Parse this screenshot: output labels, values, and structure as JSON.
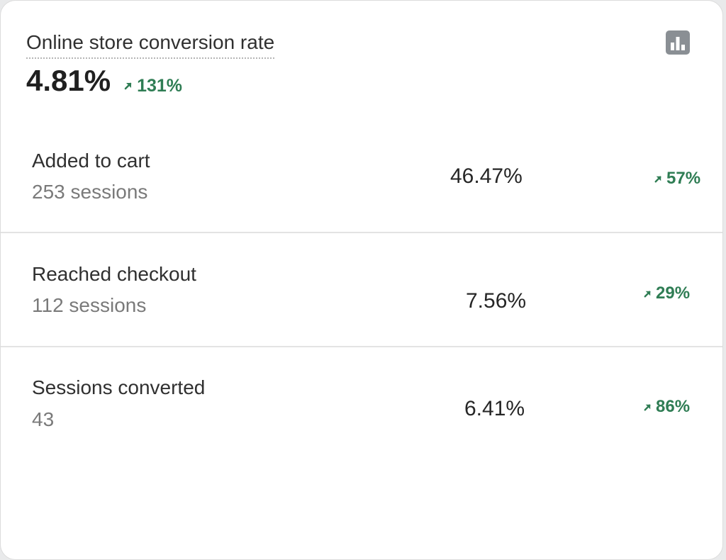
{
  "card": {
    "title": "Online store conversion rate",
    "value": "4.81%",
    "change": "131%",
    "chart_icon": "bar-chart-icon"
  },
  "rows": [
    {
      "label": "Added to cart",
      "sub": "253 sessions",
      "value": "46.47%",
      "change": "57%"
    },
    {
      "label": "Reached checkout",
      "sub": "112 sessions",
      "value": "7.56%",
      "change": "29%"
    },
    {
      "label": "Sessions converted",
      "sub": "43",
      "value": "6.41%",
      "change": "86%"
    }
  ],
  "colors": {
    "positive_trend": "#2f7d54",
    "icon_gray": "#8a8f94"
  },
  "icons": {
    "trend": "arrow-up-right-icon"
  }
}
